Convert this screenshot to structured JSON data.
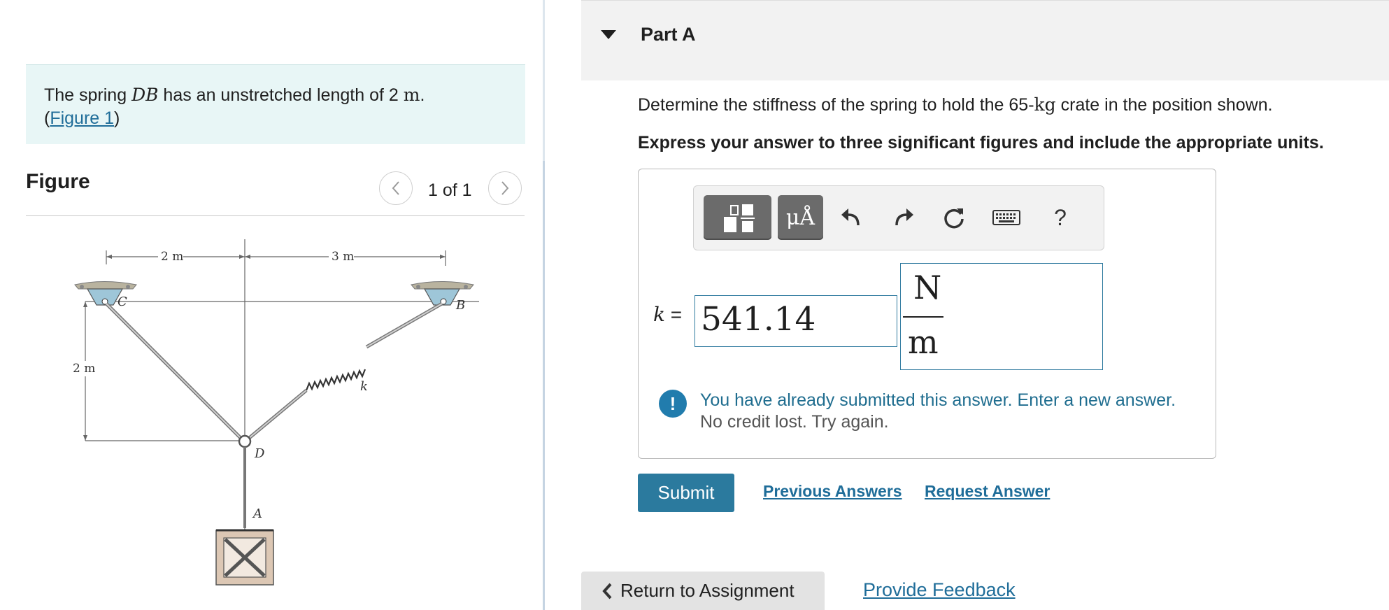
{
  "problem": {
    "text_before": "The spring ",
    "spring_name": "DB",
    "text_mid": " has an unstretched length of 2 ",
    "unit": "m",
    "text_end": ".",
    "paren_open": "(",
    "figure_link": "Figure 1",
    "paren_close": ")"
  },
  "figure": {
    "title": "Figure",
    "pager": "1 of 1",
    "prev_icon": "chevron-left-icon",
    "next_icon": "chevron-right-icon",
    "labels": {
      "dim_left": "2 m",
      "dim_right": "3 m",
      "dim_vertical": "2 m",
      "point_c": "C",
      "point_b": "B",
      "point_d": "D",
      "point_a": "A",
      "spring_k": "k"
    }
  },
  "part": {
    "title": "Part A",
    "question_before": "Determine the stiffness of the spring to hold the 65-",
    "question_unit": "kg",
    "question_after": " crate in the position shown.",
    "instruction": "Express your answer to three significant figures and include the appropriate units."
  },
  "toolbar": {
    "units_button": "μÅ",
    "help": "?",
    "icons": [
      "templates-icon",
      "units-icon",
      "undo-icon",
      "redo-icon",
      "reset-icon",
      "keyboard-icon",
      "help-icon"
    ]
  },
  "answer": {
    "variable": "k",
    "equals": "=",
    "value": "541.14",
    "unit_numerator": "N",
    "unit_denominator": "m"
  },
  "alert": {
    "icon": "!",
    "line1": "You have already submitted this answer. Enter a new answer.",
    "line2": "No credit lost. Try again."
  },
  "actions": {
    "submit": "Submit",
    "previous_answers": "Previous Answers",
    "request_answer": "Request Answer"
  },
  "footer": {
    "return": "Return to Assignment",
    "feedback": "Provide Feedback"
  },
  "colors": {
    "accent": "#2b7a9e",
    "link": "#1f6d99",
    "intro_bg": "#e8f6f6",
    "alert_icon": "#217cad"
  }
}
